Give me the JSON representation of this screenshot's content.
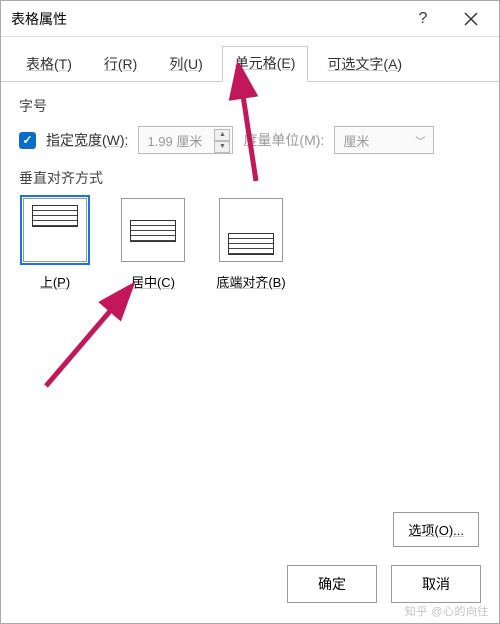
{
  "title": "表格属性",
  "help_symbol": "?",
  "tabs": [
    "表格(T)",
    "行(R)",
    "列(U)",
    "单元格(E)",
    "可选文字(A)"
  ],
  "active_tab_index": 3,
  "size_section_label": "字号",
  "spec_width_label": "指定宽度(W):",
  "spec_width_value": "1.99 厘米",
  "unit_label": "度量单位(M):",
  "unit_value": "厘米",
  "valign_label": "垂直对齐方式",
  "align_options": [
    {
      "label": "上(P)"
    },
    {
      "label": "居中(C)"
    },
    {
      "label": "底端对齐(B)"
    }
  ],
  "selected_align_index": 0,
  "options_button": "选项(O)...",
  "ok_button": "确定",
  "cancel_button": "取消",
  "watermark": "知乎 @心的向往",
  "colors": {
    "accent": "#0a6cc9",
    "arrow": "#c2185b"
  }
}
